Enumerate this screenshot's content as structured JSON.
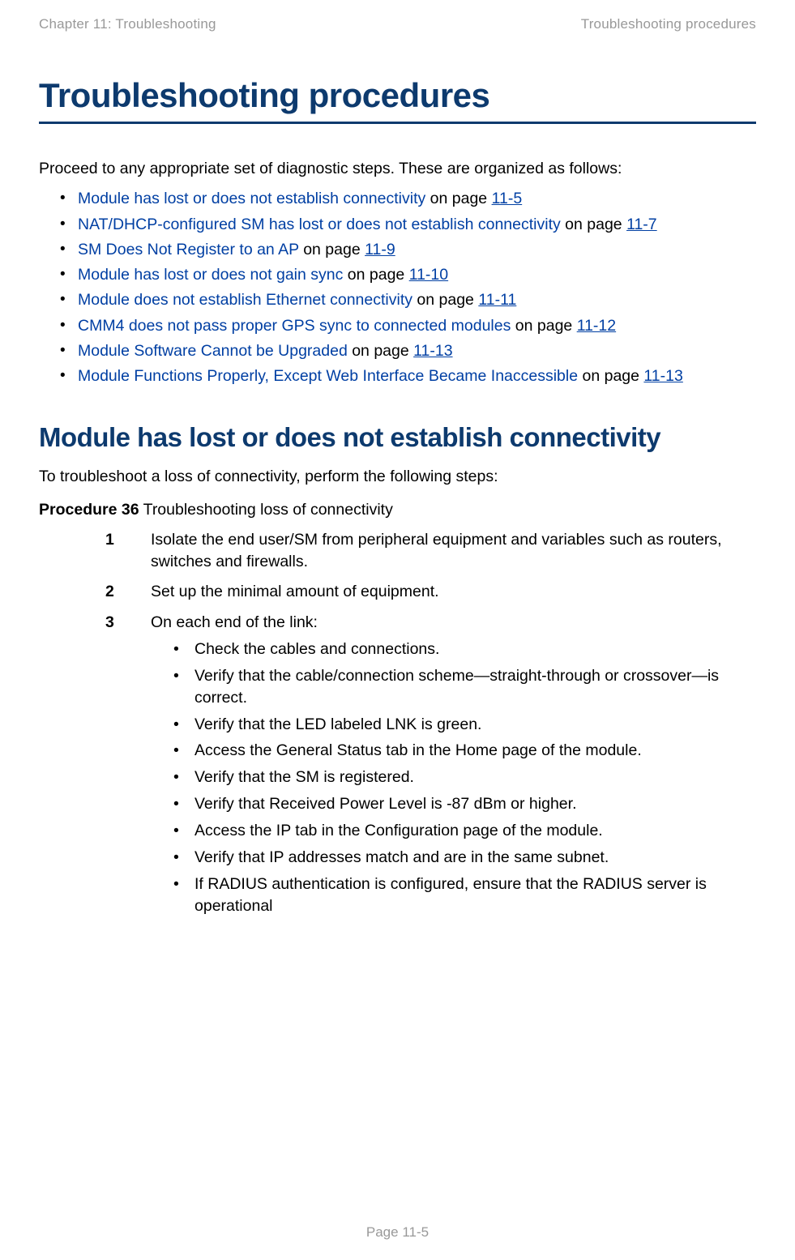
{
  "header": {
    "left": "Chapter 11:  Troubleshooting",
    "right": "Troubleshooting procedures"
  },
  "title": "Troubleshooting procedures",
  "intro": "Proceed to any appropriate set of diagnostic steps. These are organized as follows:",
  "links": [
    {
      "text": "Module has lost or does not establish connectivity",
      "suffix": " on page ",
      "page": "11-5"
    },
    {
      "text": "NAT/DHCP-configured SM has lost or does not establish connectivity",
      "suffix": " on page ",
      "page": "11-7"
    },
    {
      "text": "SM Does Not Register to an AP",
      "suffix": " on page ",
      "page": "11-9"
    },
    {
      "text": "Module has lost or does not gain sync",
      "suffix": " on page ",
      "page": "11-10"
    },
    {
      "text": "Module does not establish Ethernet connectivity",
      "suffix": " on page ",
      "page": "11-11"
    },
    {
      "text": "CMM4 does not pass proper GPS sync to connected modules",
      "suffix": " on page ",
      "page": "11-12"
    },
    {
      "text": "Module Software Cannot be Upgraded",
      "suffix": " on page ",
      "page": "11-13"
    },
    {
      "text": "Module Functions Properly, Except Web Interface Became Inaccessible",
      "suffix": " on page ",
      "page": "11-13"
    }
  ],
  "section_title": "Module has lost or does not establish connectivity",
  "section_intro": "To troubleshoot a loss of connectivity, perform the following steps:",
  "procedure": {
    "label_strong": "Procedure 36",
    "label_rest": " Troubleshooting loss of connectivity",
    "steps": [
      {
        "num": "1",
        "text": "Isolate the end user/SM from peripheral equipment and variables such as routers, switches and firewalls."
      },
      {
        "num": "2",
        "text": "Set up the minimal amount of equipment."
      },
      {
        "num": "3",
        "text": "On each end of the link:",
        "sub": [
          "Check the cables and connections.",
          "Verify that the cable/connection scheme—straight-through or crossover—is correct.",
          "Verify that the LED labeled LNK is green.",
          "Access the General Status tab in the Home page of the module.",
          "Verify that the SM is registered.",
          "Verify that Received Power Level is -87 dBm or higher.",
          "Access the IP tab in the Configuration page of the module.",
          "Verify that IP addresses match and are in the same subnet.",
          "If RADIUS authentication is configured, ensure that the RADIUS server is operational"
        ]
      }
    ]
  },
  "footer": "Page 11-5"
}
